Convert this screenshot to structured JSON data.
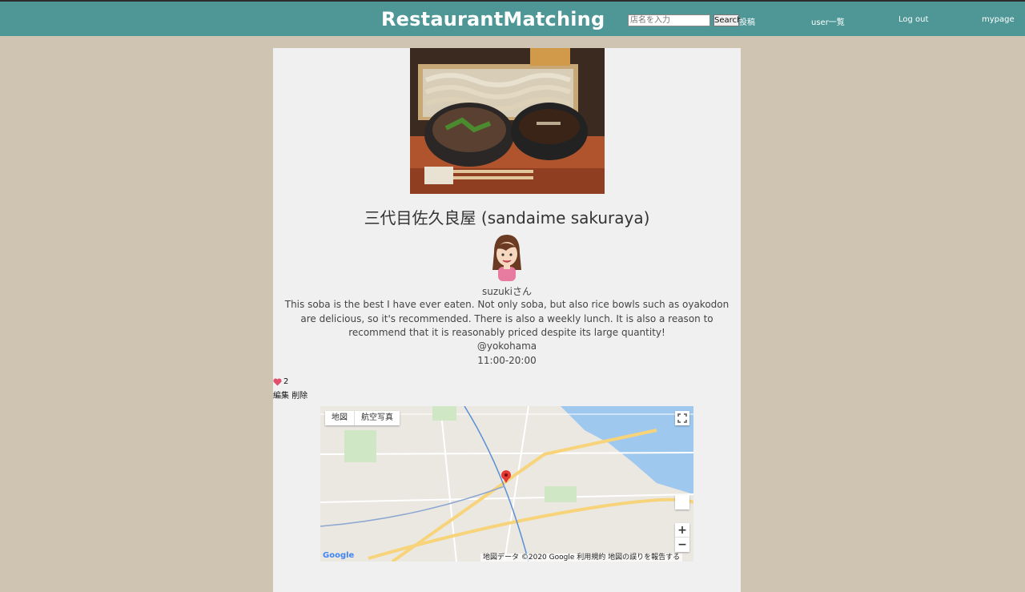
{
  "header": {
    "brand": "RestaurantMatching",
    "search_placeholder": "店名を入力",
    "search_button": "Search",
    "nav": {
      "post": "投稿",
      "users": "user一覧",
      "logout": "Log out",
      "mypage": "mypage"
    }
  },
  "post": {
    "title": "三代目佐久良屋 (sandaime sakuraya)",
    "username": "suzukiさん",
    "description": "This soba is the best I have ever eaten. Not only soba, but also rice bowls such as oyakodon are delicious, so it's recommended. There is also a weekly lunch. It is also a reason to recommend that it is reasonably priced despite its large quantity!",
    "location": "@yokohama",
    "hours": "11:00-20:00",
    "likes": "2",
    "edit": "編集",
    "delete": "削除"
  },
  "map": {
    "tab_map": "地図",
    "tab_satellite": "航空写真",
    "zoom_in": "+",
    "zoom_out": "−",
    "google": "Google",
    "attribution": "地図データ ©2020 Google",
    "terms": "利用規約",
    "report": "地図の誤りを報告する"
  },
  "colors": {
    "header": "#4f9797",
    "background": "#cfc3b2",
    "card": "#f0f0f0",
    "heart": "#e0506e",
    "map_pin": "#e53935"
  }
}
